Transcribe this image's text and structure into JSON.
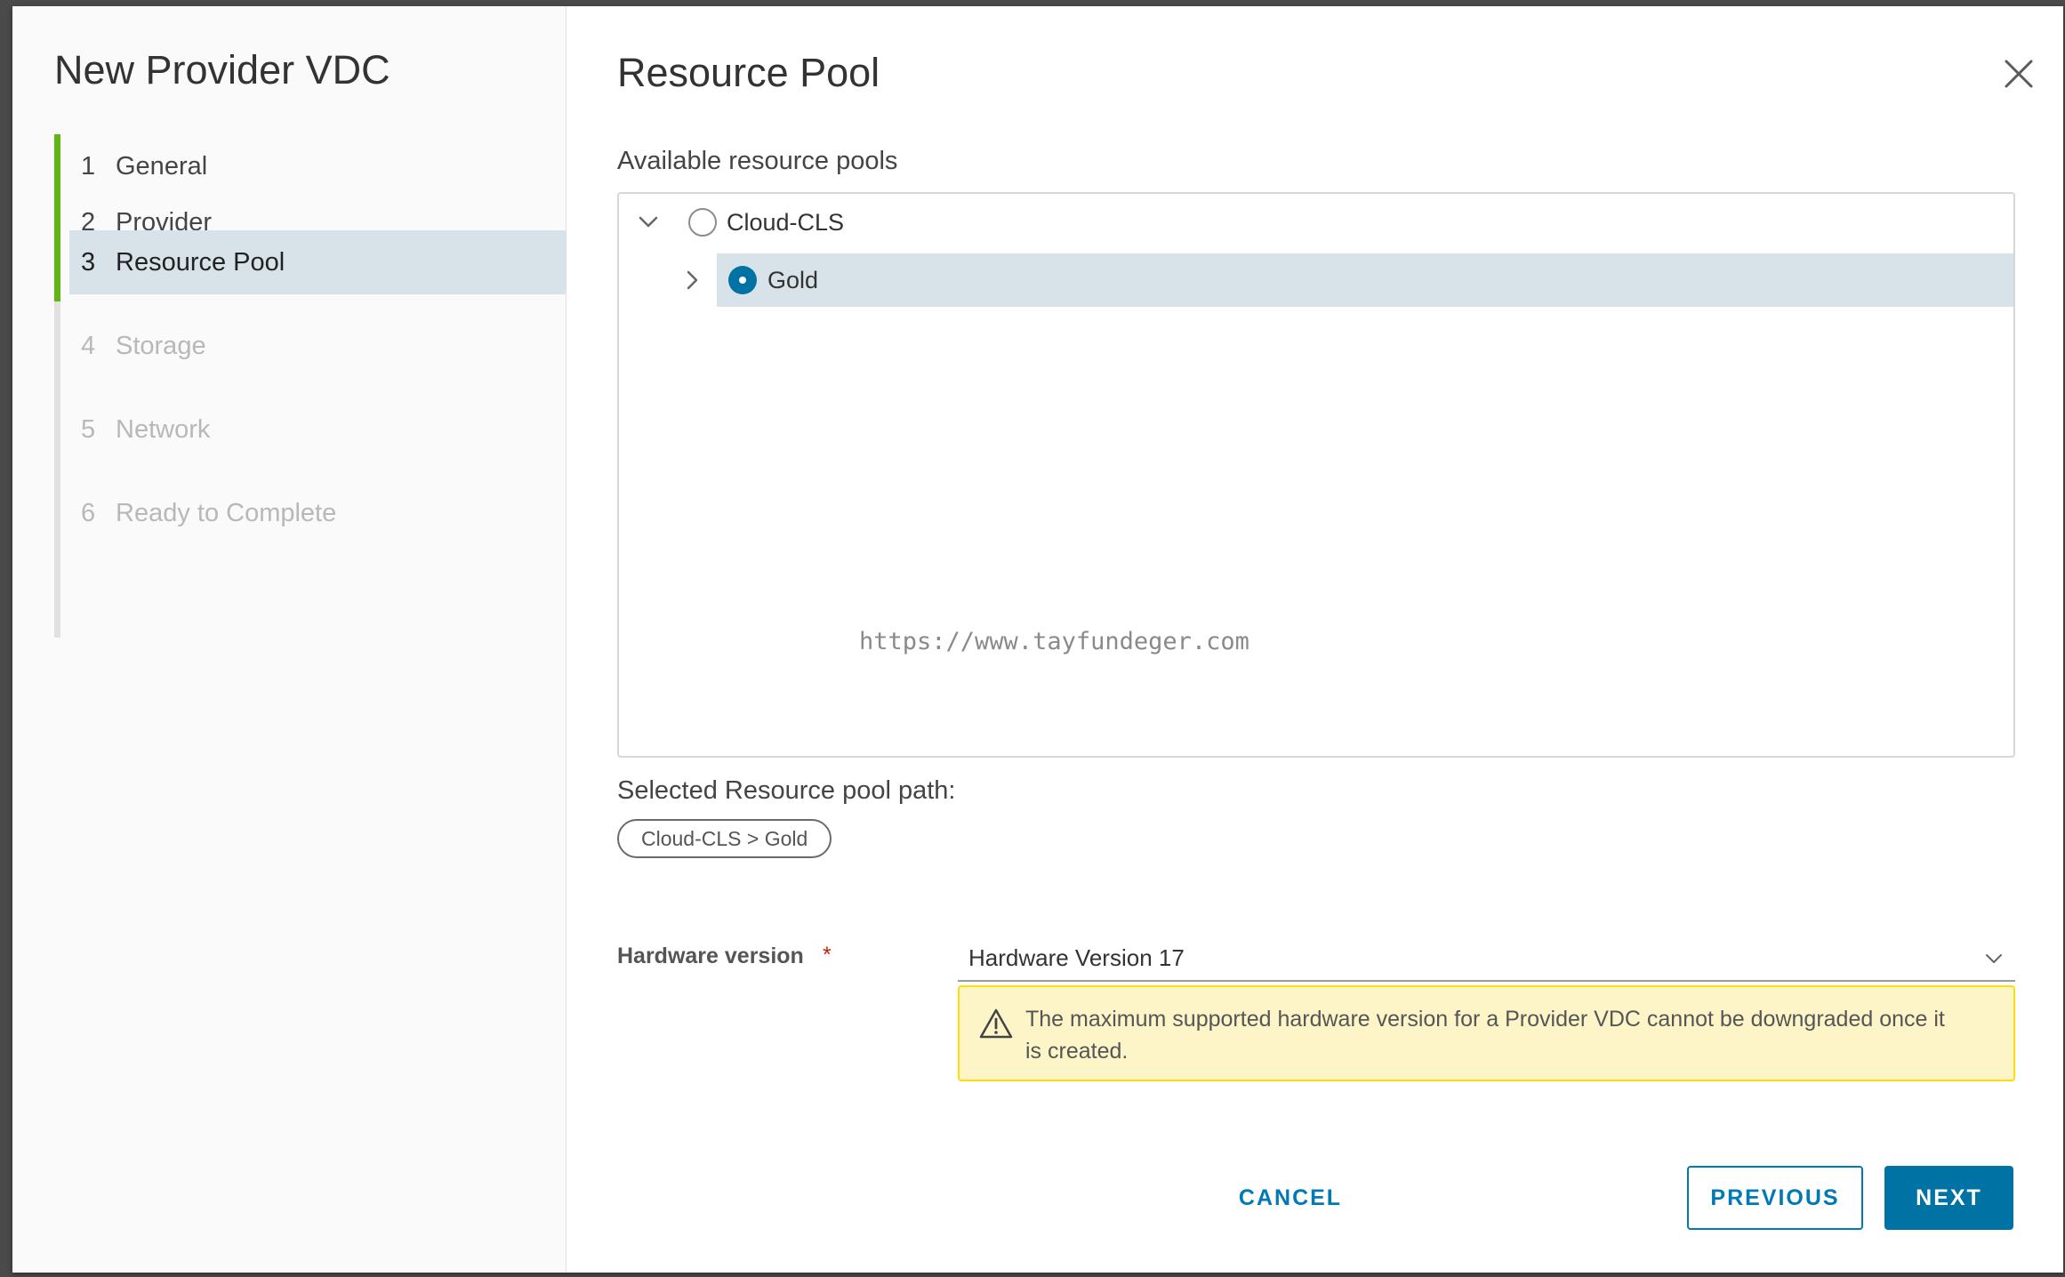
{
  "wizard": {
    "title": "New Provider VDC",
    "steps": [
      {
        "num": "1",
        "label": "General",
        "state": "done"
      },
      {
        "num": "2",
        "label": "Provider",
        "state": "done"
      },
      {
        "num": "3",
        "label": "Resource Pool",
        "state": "active"
      },
      {
        "num": "4",
        "label": "Storage",
        "state": "pending"
      },
      {
        "num": "5",
        "label": "Network",
        "state": "pending"
      },
      {
        "num": "6",
        "label": "Ready to Complete",
        "state": "pending"
      }
    ]
  },
  "main": {
    "title": "Resource Pool",
    "close_icon": "close-icon",
    "available_label": "Available resource pools",
    "tree": [
      {
        "label": "Cloud-CLS",
        "expanded": true,
        "selected": false,
        "caret_icon": "chevron-down-icon"
      },
      {
        "label": "Gold",
        "expanded": false,
        "selected": true,
        "caret_icon": "chevron-right-icon"
      }
    ],
    "watermark": "https://www.tayfundeger.com",
    "selected_path_label": "Selected Resource pool path:",
    "selected_path": "Cloud-CLS > Gold",
    "hardware": {
      "label": "Hardware version",
      "required_mark": "*",
      "value": "Hardware Version 17",
      "chevron_icon": "chevron-down-icon"
    },
    "warning": {
      "icon": "warning-icon",
      "text": "The maximum supported hardware version for a Provider VDC cannot be downgraded once it is created."
    }
  },
  "footer": {
    "cancel": "CANCEL",
    "previous": "PREVIOUS",
    "next": "NEXT"
  },
  "colors": {
    "accent": "#0072a3",
    "link": "#0079b8",
    "completed_step": "#60b515",
    "active_row": "#d8e3e9",
    "warning_bg": "#fdf4c7",
    "warning_border": "#ffdc0b",
    "required": "#c92100"
  }
}
